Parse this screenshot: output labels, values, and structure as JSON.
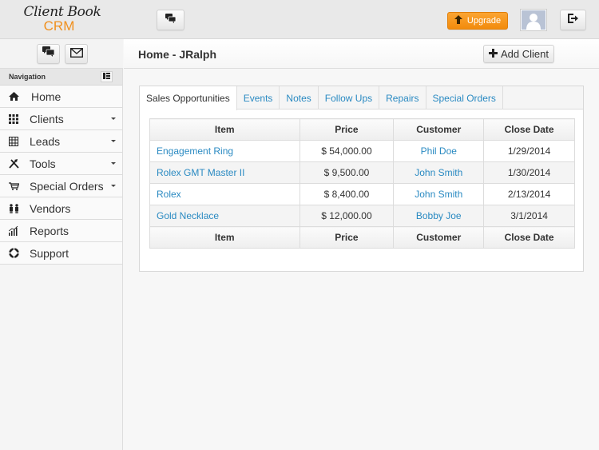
{
  "header": {
    "logo_line1": "Client Book",
    "logo_line2": "CRM",
    "upgrade_label": "Upgrade",
    "accent_color": "#f28b0c"
  },
  "page": {
    "title": "Home - JRalph",
    "add_client_label": "Add Client"
  },
  "sidebar": {
    "heading": "Navigation",
    "items": [
      {
        "label": "Home",
        "icon": "home-icon",
        "has_dropdown": false
      },
      {
        "label": "Clients",
        "icon": "grid-icon",
        "has_dropdown": true
      },
      {
        "label": "Leads",
        "icon": "table-icon",
        "has_dropdown": true
      },
      {
        "label": "Tools",
        "icon": "tools-icon",
        "has_dropdown": true
      },
      {
        "label": "Special Orders",
        "icon": "cart-icon",
        "has_dropdown": true
      },
      {
        "label": "Vendors",
        "icon": "users-icon",
        "has_dropdown": false
      },
      {
        "label": "Reports",
        "icon": "chart-icon",
        "has_dropdown": false
      },
      {
        "label": "Support",
        "icon": "lifebuoy-icon",
        "has_dropdown": false
      }
    ]
  },
  "tabs": [
    {
      "label": "Sales Opportunities",
      "active": true
    },
    {
      "label": "Events",
      "active": false
    },
    {
      "label": "Notes",
      "active": false
    },
    {
      "label": "Follow Ups",
      "active": false
    },
    {
      "label": "Repairs",
      "active": false
    },
    {
      "label": "Special Orders",
      "active": false
    }
  ],
  "table": {
    "columns": [
      "Item",
      "Price",
      "Customer",
      "Close Date"
    ],
    "rows": [
      {
        "item": "Engagement Ring",
        "price": "$ 54,000.00",
        "customer": "Phil Doe",
        "close_date": "1/29/2014"
      },
      {
        "item": "Rolex GMT Master II",
        "price": "$ 9,500.00",
        "customer": "John Smith",
        "close_date": "1/30/2014"
      },
      {
        "item": "Rolex",
        "price": "$ 8,400.00",
        "customer": "John Smith",
        "close_date": "2/13/2014"
      },
      {
        "item": "Gold Necklace",
        "price": "$ 12,000.00",
        "customer": "Bobby Joe",
        "close_date": "3/1/2014"
      }
    ]
  }
}
